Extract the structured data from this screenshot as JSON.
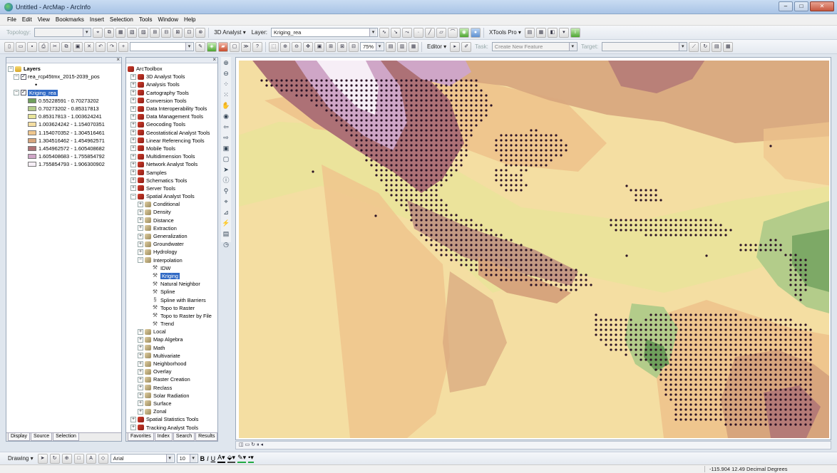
{
  "window": {
    "title": "Untitled - ArcMap - ArcInfo"
  },
  "menu": [
    "File",
    "Edit",
    "View",
    "Bookmarks",
    "Insert",
    "Selection",
    "Tools",
    "Window",
    "Help"
  ],
  "toolbar1": {
    "topology_label": "Topology:",
    "analyst_label": "3D Analyst ▾",
    "layer_label": "Layer:",
    "layer_value": "Kriging_rea",
    "xtools_label": "XTools Pro ▾"
  },
  "toolbar2": {
    "zoom_value": "75%",
    "editor_label": "Editor ▾",
    "task_label": "Task:",
    "task_value": "Create New Feature",
    "target_label": "Target:"
  },
  "toc": {
    "root": "Layers",
    "layer1": "rea_rcp45tmx_2015-2039_pos",
    "layer2": "Kriging_rea",
    "legend": [
      {
        "label": "0.55228591 - 0.70273202",
        "color": "#6fa05c"
      },
      {
        "label": "0.70273202 - 0.85317813",
        "color": "#b3cc8a"
      },
      {
        "label": "0.85317813 - 1.003624241",
        "color": "#e8e49a"
      },
      {
        "label": "1.003624242 - 1.154070351",
        "color": "#f4dea2"
      },
      {
        "label": "1.154070352 - 1.304516461",
        "color": "#efc68e"
      },
      {
        "label": "1.304516462 - 1.454962571",
        "color": "#d7a57d"
      },
      {
        "label": "1.454962572 - 1.605408682",
        "color": "#ad7176"
      },
      {
        "label": "1.605408683 - 1.755854792",
        "color": "#cfa6c7"
      },
      {
        "label": "1.755854793 - 1.906300902",
        "color": "#f6eef6"
      }
    ],
    "tabs": [
      "Display",
      "Source",
      "Selection"
    ]
  },
  "toolbox": {
    "root": "ArcToolbox",
    "items": [
      "3D Analyst Tools",
      "Analysis Tools",
      "Cartography Tools",
      "Conversion Tools",
      "Data Interoperability Tools",
      "Data Management Tools",
      "Geocoding Tools",
      "Geostatistical Analyst Tools",
      "Linear Referencing Tools",
      "Mobile Tools",
      "Multidimension Tools",
      "Network Analyst Tools",
      "Samples",
      "Schematics Tools",
      "Server Tools",
      "Spatial Analyst Tools"
    ],
    "spatial_sub": [
      "Conditional",
      "Density",
      "Distance",
      "Extraction",
      "Generalization",
      "Groundwater",
      "Hydrology",
      "Interpolation"
    ],
    "interp_tools": [
      "IDW",
      "Kriging",
      "Natural Neighbor",
      "Spline",
      "Spline with Barriers",
      "Topo to Raster",
      "Topo to Raster by File",
      "Trend"
    ],
    "spatial_sub2": [
      "Local",
      "Map Algebra",
      "Math",
      "Multivariate",
      "Neighborhood",
      "Overlay",
      "Raster Creation",
      "Reclass",
      "Solar Radiation",
      "Surface",
      "Zonal"
    ],
    "items2": [
      "Spatial Statistics Tools",
      "Tracking Analyst Tools"
    ],
    "tabs": [
      "Favorites",
      "Index",
      "Search",
      "Results"
    ]
  },
  "drawing": {
    "label": "Drawing ▾",
    "font": "Arial",
    "size": "10"
  },
  "status": {
    "coords": "-115.904  12.49 Decimal Degrees"
  },
  "colors": {
    "point": "#2b1226",
    "ramp": [
      "#6fa05c",
      "#b3cc8a",
      "#e8e49a",
      "#f4dea2",
      "#efc68e",
      "#d7a57d",
      "#ad7176",
      "#cfa6c7",
      "#f6eef6"
    ]
  },
  "map_points": {
    "spacing_px": 7,
    "radius_px": 1.6
  }
}
